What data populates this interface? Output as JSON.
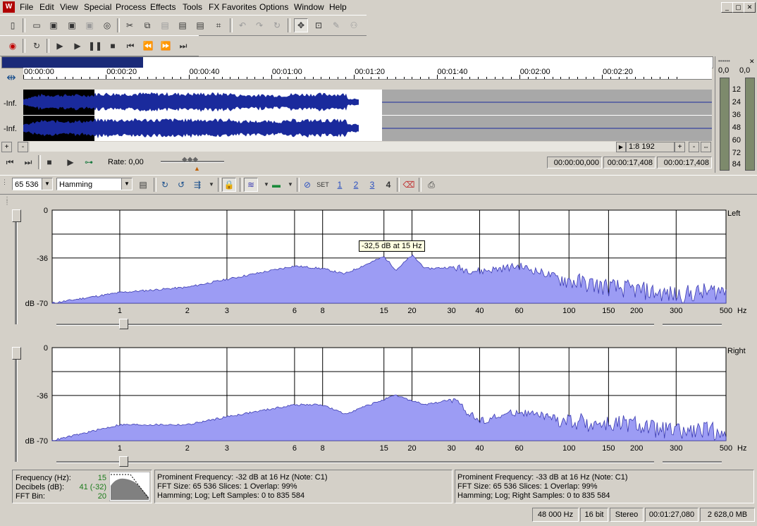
{
  "menu": {
    "items": [
      "File",
      "Edit",
      "View",
      "Special",
      "Process",
      "Effects",
      "Tools",
      "FX Favorites",
      "Options",
      "Window",
      "Help"
    ]
  },
  "window_buttons": [
    "_",
    "▢",
    "✕"
  ],
  "ruler": {
    "labels": [
      "00:00:00",
      "00:00:20",
      "00:00:40",
      "00:01:00",
      "00:01:20",
      "00:01:40",
      "00:02:00",
      "00:02:20"
    ]
  },
  "tracks": {
    "labels": [
      "-Inf.",
      "-Inf."
    ],
    "zoom": "1:8 192"
  },
  "transport2": {
    "rate_label": "Rate: 0,00",
    "time_start": "00:00:00,000",
    "time_end": "00:00:17,408",
    "time_length": "00:00:17,408"
  },
  "meter": {
    "left_peak": "0,0",
    "right_peak": "0,0",
    "ticks": [
      "12",
      "24",
      "36",
      "48",
      "60",
      "72",
      "84"
    ]
  },
  "fft_toolbar": {
    "fft_size": "65 536",
    "window": "Hamming",
    "set_label": "SET",
    "buttons": [
      "1",
      "2",
      "3",
      "4"
    ]
  },
  "spectrum": {
    "x_ticks": [
      "1",
      "2",
      "3",
      "6",
      "8",
      "15",
      "20",
      "30",
      "40",
      "60",
      "100",
      "150",
      "200",
      "300",
      "500"
    ],
    "x_unit": "Hz",
    "y_ticks": [
      "0",
      "-36",
      "dB -70"
    ],
    "tooltip": "-32,5 dB at 15 Hz",
    "left_label": "Left",
    "right_label": "Right"
  },
  "chart_data": [
    {
      "type": "area",
      "series": [
        {
          "name": "Left",
          "x": [
            0.5,
            1,
            2,
            3,
            6,
            8,
            10,
            15,
            17,
            20,
            23,
            30,
            40,
            60,
            100,
            150,
            200,
            300,
            500
          ],
          "values": [
            -70,
            -62,
            -58,
            -52,
            -42,
            -44,
            -48,
            -35,
            -45,
            -34,
            -44,
            -43,
            -46,
            -42,
            -53,
            -58,
            -60,
            -64,
            -60
          ]
        }
      ],
      "xscale": "log",
      "xlabel": "Hz",
      "ylabel": "dB",
      "ylim": [
        -70,
        0
      ],
      "xlim": [
        0.5,
        500
      ],
      "yticks": [
        0,
        -36,
        -70
      ]
    },
    {
      "type": "area",
      "series": [
        {
          "name": "Right",
          "x": [
            0.5,
            1,
            2,
            3,
            6,
            8,
            10,
            15,
            17,
            20,
            23,
            30,
            40,
            60,
            100,
            150,
            200,
            300,
            500
          ],
          "values": [
            -70,
            -58,
            -58,
            -52,
            -43,
            -43,
            -50,
            -39,
            -36,
            -40,
            -43,
            -39,
            -55,
            -48,
            -55,
            -58,
            -58,
            -64,
            -62
          ]
        }
      ],
      "xscale": "log",
      "xlabel": "Hz",
      "ylabel": "dB",
      "ylim": [
        -70,
        0
      ],
      "xlim": [
        0.5,
        500
      ],
      "yticks": [
        0,
        -36,
        -70
      ]
    }
  ],
  "status_left": {
    "freq_label": "Frequency (Hz):",
    "freq_value": "15",
    "db_label": "Decibels (dB):",
    "db_value": "41 (-32)",
    "bin_label": "FFT Bin:",
    "bin_value": "20"
  },
  "status_mid": {
    "line1": "Prominent Frequency: -32 dB at 16 Hz (Note: C1)",
    "line2": "FFT Size: 65 536  Slices: 1  Overlap: 99%",
    "line3": "Hamming; Log; Left  Samples: 0 to 835 584"
  },
  "status_right": {
    "line1": "Prominent Frequency: -33 dB at 16 Hz (Note: C1)",
    "line2": "FFT Size: 65 536  Slices: 1  Overlap: 99%",
    "line3": "Hamming; Log; Right  Samples: 0 to 835 584"
  },
  "statusbar": {
    "rate": "48 000 Hz",
    "bits": "16 bit",
    "channels": "Stereo",
    "length": "00:01:27,080",
    "free": "2 628,0 MB"
  },
  "colors": {
    "spectrum_fill": "#9c9cf4",
    "spectrum_stroke": "#3a3ab0",
    "wave": "#1a2a9c"
  }
}
